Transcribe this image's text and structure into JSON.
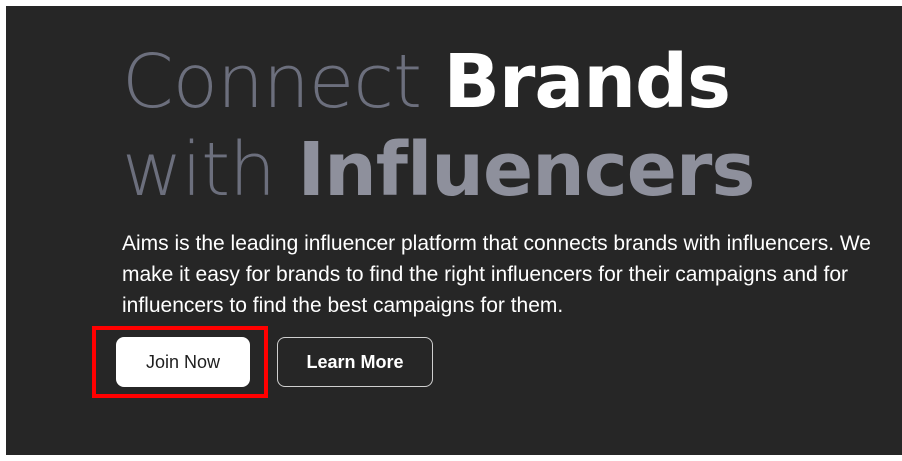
{
  "hero": {
    "headline_line1_light": "Connect ",
    "headline_line1_bold": "Brands",
    "headline_line2_light": "with ",
    "headline_line2_bold": "Influencers",
    "description": "Aims is the leading influencer platform that connects brands with influencers. We make it easy for brands to find the right influencers for their campaigns and for influencers to find the best campaigns for them."
  },
  "buttons": {
    "join_label": "Join Now",
    "learn_label": "Learn More"
  },
  "colors": {
    "background": "#262626",
    "highlight": "#ff0000",
    "headline_light": "#6c6f7d",
    "headline_bold_white": "#ffffff",
    "headline_bold_gray": "#8e909c"
  }
}
